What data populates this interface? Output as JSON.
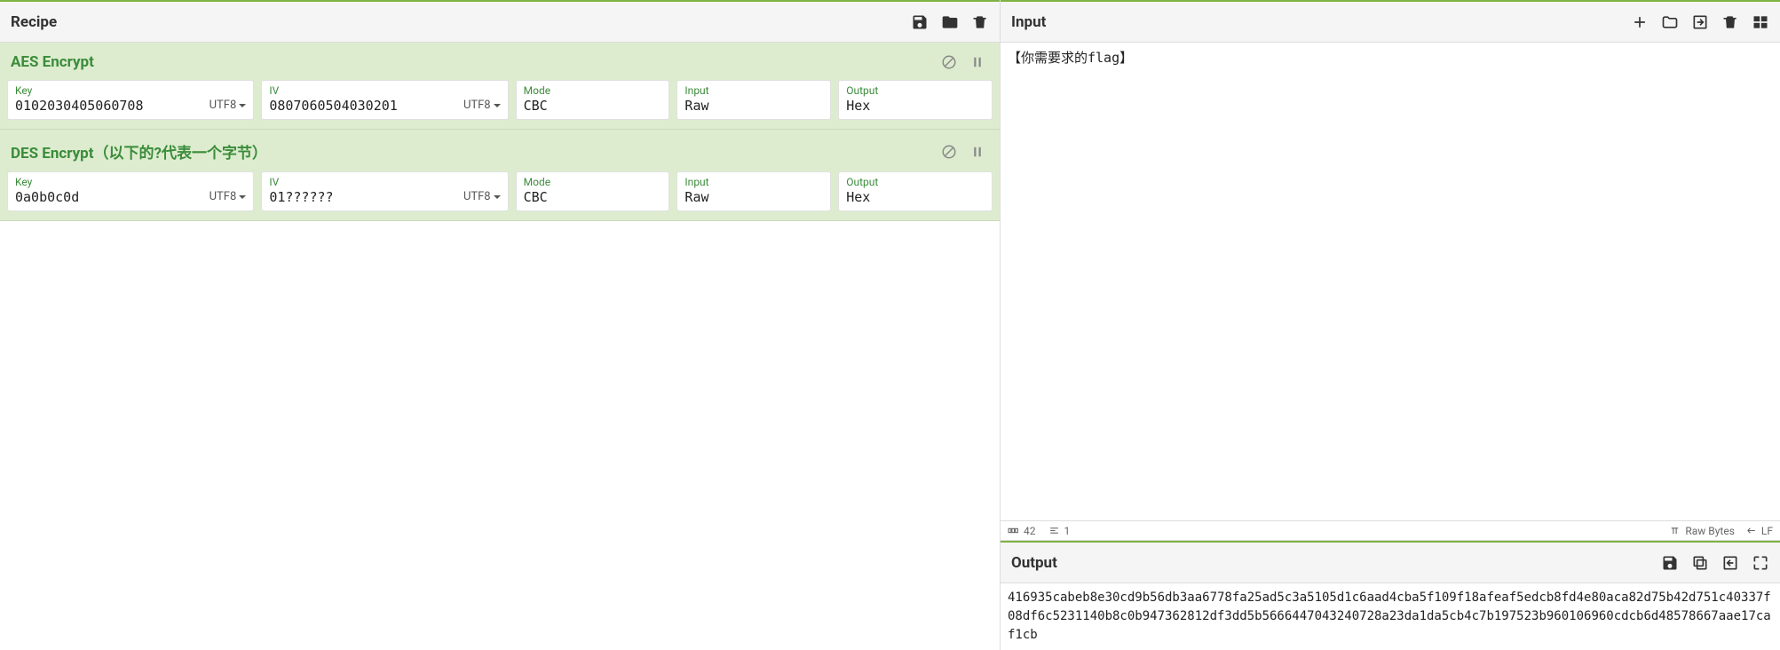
{
  "recipe": {
    "title": "Recipe",
    "ops": [
      {
        "title": "AES Encrypt",
        "key_label": "Key",
        "key_value": "0102030405060708",
        "key_enc": "UTF8",
        "iv_label": "IV",
        "iv_value": "0807060504030201",
        "iv_enc": "UTF8",
        "mode_label": "Mode",
        "mode_value": "CBC",
        "input_label": "Input",
        "input_value": "Raw",
        "output_label": "Output",
        "output_value": "Hex"
      },
      {
        "title": "DES Encrypt（以下的?代表一个字节）",
        "key_label": "Key",
        "key_value": "0a0b0c0d",
        "key_enc": "UTF8",
        "iv_label": "IV",
        "iv_value": "01??????",
        "iv_enc": "UTF8",
        "mode_label": "Mode",
        "mode_value": "CBC",
        "input_label": "Input",
        "input_value": "Raw",
        "output_label": "Output",
        "output_value": "Hex"
      }
    ]
  },
  "input": {
    "title": "Input",
    "text": "【你需要求的flag】"
  },
  "status": {
    "chars": "42",
    "lines": "1",
    "encoding": "Raw Bytes",
    "eol": "LF"
  },
  "output": {
    "title": "Output",
    "text": "416935cabeb8e30cd9b56db3aa6778fa25ad5c3a5105d1c6aad4cba5f109f18afeaf5edcb8fd4e80aca82d75b42d751c40337f08df6c5231140b8c0b947362812df3dd5b5666447043240728a23da1da5cb4c7b197523b960106960cdcb6d48578667aae17caf1cb"
  }
}
